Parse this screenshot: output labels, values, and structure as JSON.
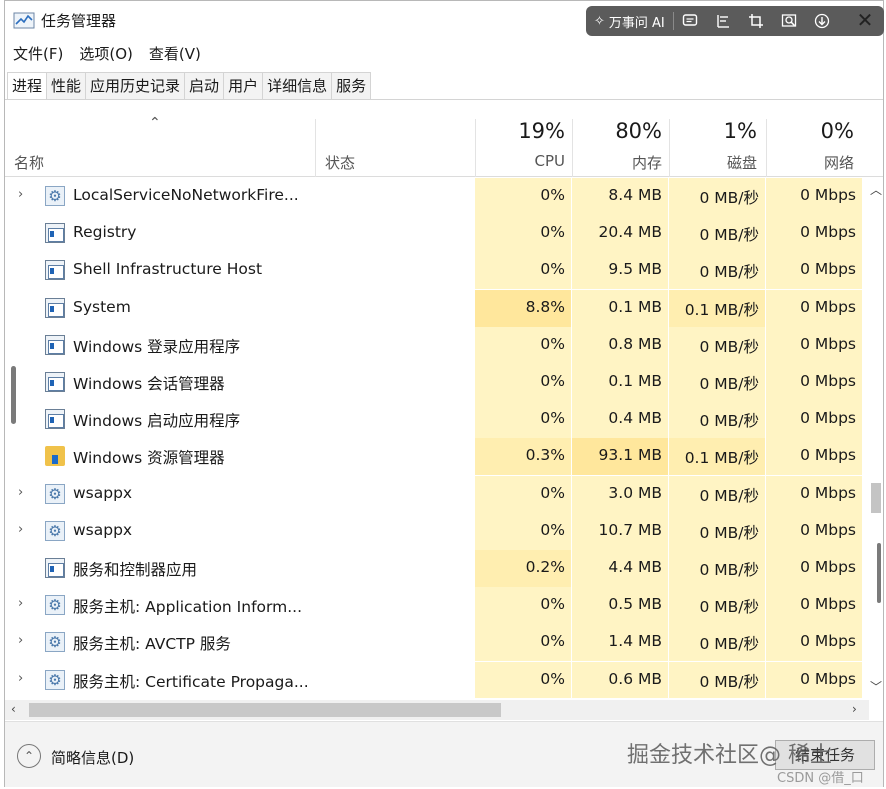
{
  "window": {
    "title": "任务管理器"
  },
  "ai_toolbar": {
    "label": "万事问 AI",
    "tools": [
      "comment-icon",
      "format-icon",
      "crop-icon",
      "zoom-icon",
      "download-icon"
    ]
  },
  "menu": [
    "文件(F)",
    "选项(O)",
    "查看(V)"
  ],
  "tabs": [
    "进程",
    "性能",
    "应用历史记录",
    "启动",
    "用户",
    "详细信息",
    "服务"
  ],
  "header": {
    "name": "名称",
    "status": "状态",
    "cpu": {
      "pct": "19%",
      "label": "CPU"
    },
    "memory": {
      "pct": "80%",
      "label": "内存"
    },
    "disk": {
      "pct": "1%",
      "label": "磁盘"
    },
    "network": {
      "pct": "0%",
      "label": "网络"
    }
  },
  "processes": [
    {
      "name": "LocalServiceNoNetworkFire...",
      "expandable": true,
      "icon": "gear-icon",
      "cpu": "0%",
      "memory": "8.4 MB",
      "disk": "0 MB/秒",
      "network": "0 Mbps"
    },
    {
      "name": "Registry",
      "expandable": false,
      "icon": "app-icon",
      "cpu": "0%",
      "memory": "20.4 MB",
      "disk": "0 MB/秒",
      "network": "0 Mbps"
    },
    {
      "name": "Shell Infrastructure Host",
      "expandable": false,
      "icon": "app-icon",
      "cpu": "0%",
      "memory": "9.5 MB",
      "disk": "0 MB/秒",
      "network": "0 Mbps"
    },
    {
      "name": "System",
      "expandable": false,
      "icon": "app-icon",
      "cpu": "8.8%",
      "memory": "0.1 MB",
      "disk": "0.1 MB/秒",
      "network": "0 Mbps"
    },
    {
      "name": "Windows 登录应用程序",
      "expandable": false,
      "icon": "app-icon",
      "cpu": "0%",
      "memory": "0.8 MB",
      "disk": "0 MB/秒",
      "network": "0 Mbps"
    },
    {
      "name": "Windows 会话管理器",
      "expandable": false,
      "icon": "app-icon",
      "cpu": "0%",
      "memory": "0.1 MB",
      "disk": "0 MB/秒",
      "network": "0 Mbps"
    },
    {
      "name": "Windows 启动应用程序",
      "expandable": false,
      "icon": "app-icon",
      "cpu": "0%",
      "memory": "0.4 MB",
      "disk": "0 MB/秒",
      "network": "0 Mbps"
    },
    {
      "name": "Windows 资源管理器",
      "expandable": false,
      "icon": "folder-icon",
      "cpu": "0.3%",
      "memory": "93.1 MB",
      "disk": "0.1 MB/秒",
      "network": "0 Mbps"
    },
    {
      "name": "wsappx",
      "expandable": true,
      "icon": "gear-icon",
      "cpu": "0%",
      "memory": "3.0 MB",
      "disk": "0 MB/秒",
      "network": "0 Mbps"
    },
    {
      "name": "wsappx",
      "expandable": true,
      "icon": "gear-icon",
      "cpu": "0%",
      "memory": "10.7 MB",
      "disk": "0 MB/秒",
      "network": "0 Mbps"
    },
    {
      "name": "服务和控制器应用",
      "expandable": false,
      "icon": "app-icon",
      "cpu": "0.2%",
      "memory": "4.4 MB",
      "disk": "0 MB/秒",
      "network": "0 Mbps"
    },
    {
      "name": "服务主机: Application Inform...",
      "expandable": true,
      "icon": "gear-icon",
      "cpu": "0%",
      "memory": "0.5 MB",
      "disk": "0 MB/秒",
      "network": "0 Mbps"
    },
    {
      "name": "服务主机: AVCTP 服务",
      "expandable": true,
      "icon": "gear-icon",
      "cpu": "0%",
      "memory": "1.4 MB",
      "disk": "0 MB/秒",
      "network": "0 Mbps"
    },
    {
      "name": "服务主机: Certificate Propaga...",
      "expandable": true,
      "icon": "gear-icon",
      "cpu": "0%",
      "memory": "0.6 MB",
      "disk": "0 MB/秒",
      "network": "0 Mbps"
    }
  ],
  "footer": {
    "fewer_details": "简略信息(D)",
    "end_task": "结束任务",
    "watermark": "掘金技术社区@ 稀土",
    "csdn": "CSDN @借_口"
  }
}
